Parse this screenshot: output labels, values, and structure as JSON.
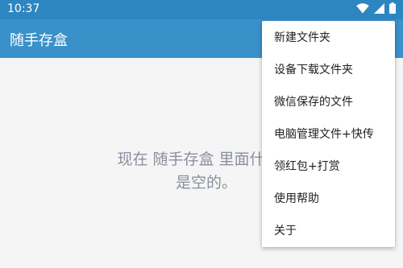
{
  "status_bar": {
    "time": "10:37",
    "icons": [
      "wifi-icon",
      "signal-icon",
      "battery-icon"
    ]
  },
  "app_bar": {
    "title": "随手存盒",
    "color": "#3a90c9"
  },
  "content": {
    "empty_message": "现在 随手存盒 里面什么都",
    "empty_message_line2": "是空的。"
  },
  "menu": {
    "items": [
      {
        "label": "新建文件夹"
      },
      {
        "label": "设备下载文件夹"
      },
      {
        "label": "微信保存的文件"
      },
      {
        "label": "电脑管理文件+快传"
      },
      {
        "label": "领红包+打赏"
      },
      {
        "label": "使用帮助"
      },
      {
        "label": "关于"
      }
    ]
  },
  "colors": {
    "status_bar": "#2d86c0",
    "background": "#f5f5f5",
    "empty_text": "#8a8f9e"
  }
}
